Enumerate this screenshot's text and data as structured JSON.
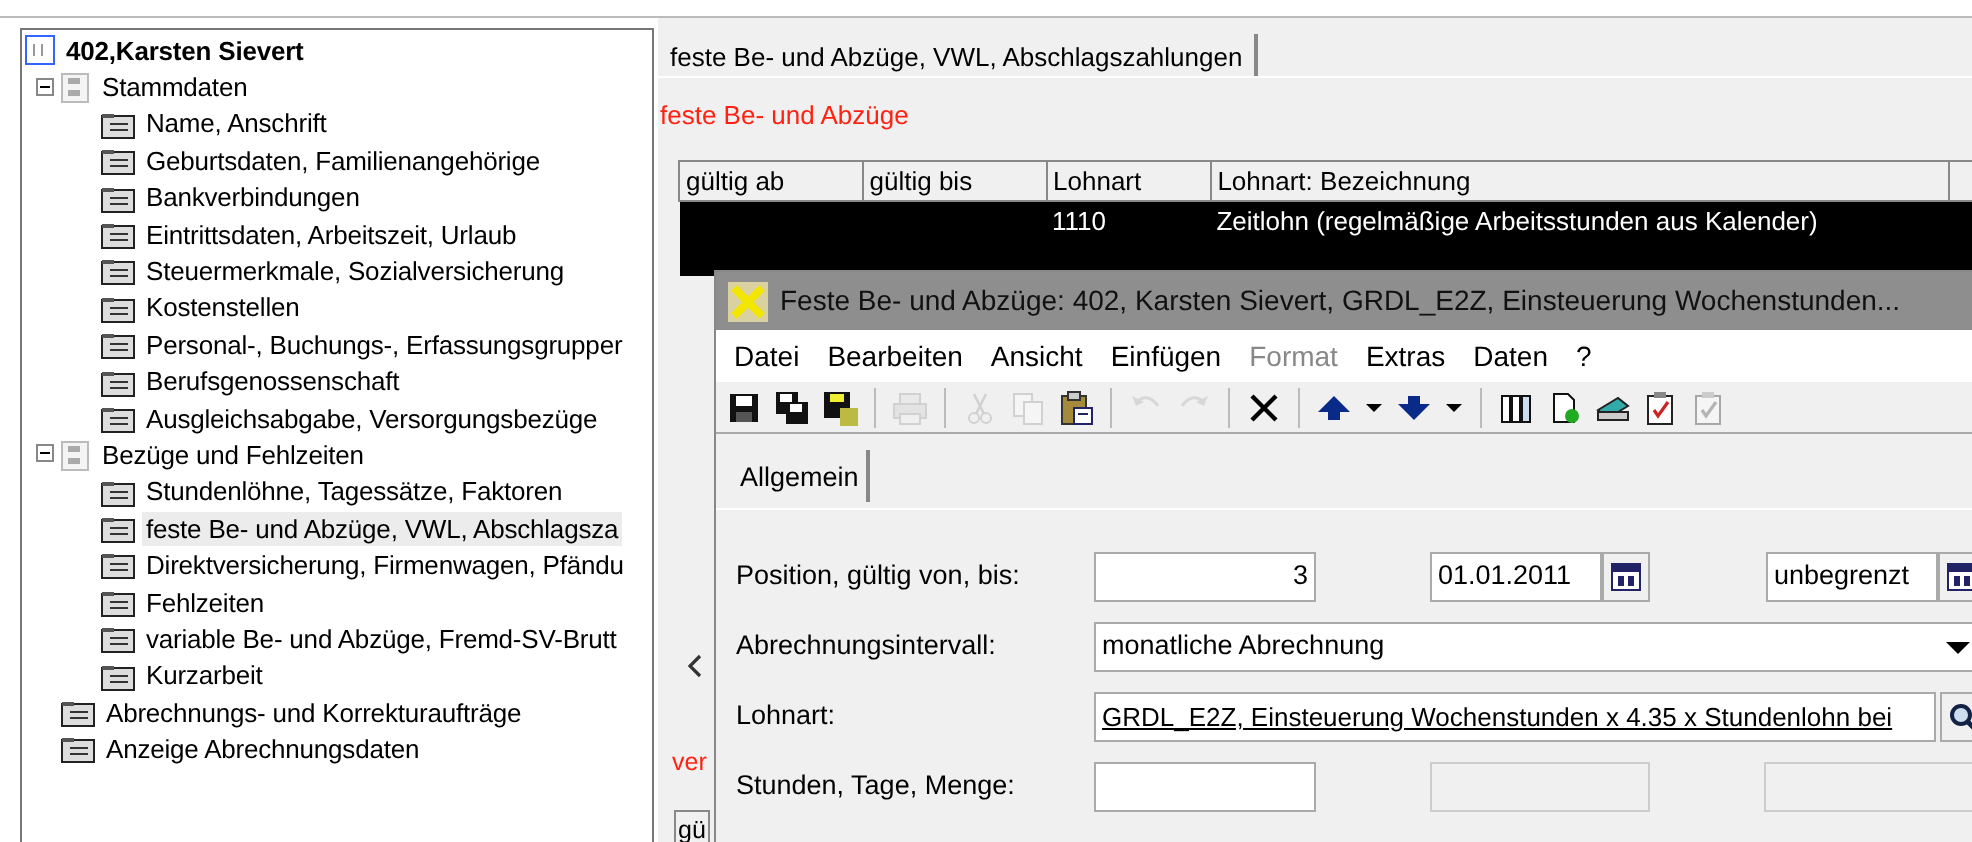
{
  "tree": {
    "label": "402,Karsten Sievert",
    "children": [
      {
        "label": "Stammdaten",
        "kind": "group",
        "expanded": true,
        "selected": false,
        "children": [
          {
            "label": "Name, Anschrift",
            "kind": "page",
            "selected": false
          },
          {
            "label": "Geburtsdaten, Familienangehörige",
            "kind": "page",
            "selected": false
          },
          {
            "label": "Bankverbindungen",
            "kind": "page",
            "selected": false
          },
          {
            "label": "Eintrittsdaten, Arbeitszeit, Urlaub",
            "kind": "page",
            "selected": false
          },
          {
            "label": "Steuermerkmale, Sozialversicherung",
            "kind": "page",
            "selected": false
          },
          {
            "label": "Kostenstellen",
            "kind": "page",
            "selected": false
          },
          {
            "label": "Personal-, Buchungs-, Erfassungsgrupper",
            "kind": "page",
            "selected": false
          },
          {
            "label": "Berufsgenossenschaft",
            "kind": "page",
            "selected": false
          },
          {
            "label": "Ausgleichsabgabe, Versorgungsbezüge",
            "kind": "page",
            "selected": false
          }
        ]
      },
      {
        "label": "Bezüge und Fehlzeiten",
        "kind": "group",
        "expanded": true,
        "selected": false,
        "children": [
          {
            "label": "Stundenlöhne, Tagessätze, Faktoren",
            "kind": "page",
            "selected": false
          },
          {
            "label": "feste Be- und Abzüge, VWL, Abschlagsza",
            "kind": "page",
            "selected": true
          },
          {
            "label": "Direktversicherung, Firmenwagen, Pfändu",
            "kind": "page",
            "selected": false
          },
          {
            "label": "Fehlzeiten",
            "kind": "page",
            "selected": false
          },
          {
            "label": "variable Be- und Abzüge, Fremd-SV-Brutt",
            "kind": "page",
            "selected": false
          },
          {
            "label": "Kurzarbeit",
            "kind": "page",
            "selected": false
          }
        ]
      },
      {
        "label": "Abrechnungs- und Korrekturaufträge",
        "kind": "page",
        "selected": false
      },
      {
        "label": "Anzeige Abrechnungsdaten",
        "kind": "page",
        "selected": false
      }
    ]
  },
  "main": {
    "tabs": [
      {
        "label": "feste Be- und Abzüge, VWL, Abschlagszahlungen",
        "selected": true
      }
    ],
    "section_title": "feste Be- und Abzüge",
    "table": {
      "columns": [
        "gültig ab",
        "gültig bis",
        "Lohnart",
        "Lohnart: Bezeichnung"
      ],
      "rows": [
        {
          "cells": [
            "",
            "",
            "1110",
            "Zeitlohn (regelmäßige Arbeitsstunden aus Kalender)"
          ],
          "selected": true
        },
        {
          "cells": [
            "",
            "",
            "",
            ""
          ],
          "selected": true
        }
      ]
    },
    "second_section_title": "ver",
    "second_table": {
      "columns": [
        "gü"
      ]
    }
  },
  "dialog": {
    "title": "Feste Be- und Abzüge: 402, Karsten Sievert, GRDL_E2Z, Einsteuerung Wochenstunden...",
    "menu": [
      {
        "label": "Datei",
        "disabled": false
      },
      {
        "label": "Bearbeiten",
        "disabled": false
      },
      {
        "label": "Ansicht",
        "disabled": false
      },
      {
        "label": "Einfügen",
        "disabled": false
      },
      {
        "label": "Format",
        "disabled": true
      },
      {
        "label": "Extras",
        "disabled": false
      },
      {
        "label": "Daten",
        "disabled": false
      },
      {
        "label": "?",
        "disabled": false
      }
    ],
    "toolbar": [
      {
        "kind": "save",
        "disabled": false
      },
      {
        "kind": "save-copy",
        "disabled": false
      },
      {
        "kind": "save-close",
        "disabled": false
      },
      {
        "kind": "separator"
      },
      {
        "kind": "print",
        "disabled": true
      },
      {
        "kind": "separator"
      },
      {
        "kind": "cut",
        "disabled": true
      },
      {
        "kind": "copy",
        "disabled": true
      },
      {
        "kind": "paste",
        "disabled": false
      },
      {
        "kind": "separator"
      },
      {
        "kind": "undo",
        "disabled": true
      },
      {
        "kind": "redo",
        "disabled": true
      },
      {
        "kind": "separator"
      },
      {
        "kind": "delete",
        "disabled": false
      },
      {
        "kind": "separator"
      },
      {
        "kind": "up",
        "disabled": false
      },
      {
        "kind": "caret",
        "disabled": false
      },
      {
        "kind": "down",
        "disabled": false
      },
      {
        "kind": "caret",
        "disabled": false
      },
      {
        "kind": "separator"
      },
      {
        "kind": "binder",
        "disabled": false
      },
      {
        "kind": "new-doc",
        "disabled": false
      },
      {
        "kind": "scanner",
        "disabled": false
      },
      {
        "kind": "clipboard",
        "disabled": false
      },
      {
        "kind": "clipboard",
        "disabled": true
      }
    ],
    "tabs": [
      {
        "label": "Allgemein",
        "selected": true
      }
    ],
    "form": [
      {
        "label": "Position, gültig von, bis:",
        "fields": [
          {
            "kind": "number",
            "value": "3",
            "disabled": false
          },
          {
            "kind": "date",
            "value": "01.01.2011",
            "disabled": false
          },
          {
            "kind": "date",
            "value": "unbegrenzt",
            "disabled": false
          }
        ]
      },
      {
        "label": "Abrechnungsintervall:",
        "fields": [
          {
            "kind": "select",
            "value": "monatliche Abrechnung",
            "disabled": false
          }
        ]
      },
      {
        "label": "Lohnart:",
        "fields": [
          {
            "kind": "lookup",
            "value": "GRDL_E2Z, Einsteuerung Wochenstunden x 4.35 x Stundenlohn bei",
            "disabled": false
          }
        ]
      },
      {
        "label": "Stunden, Tage, Menge:",
        "fields": [
          {
            "kind": "number",
            "disabled": false
          },
          {
            "kind": "number",
            "disabled": true
          },
          {
            "kind": "number",
            "disabled": true
          }
        ]
      }
    ]
  }
}
